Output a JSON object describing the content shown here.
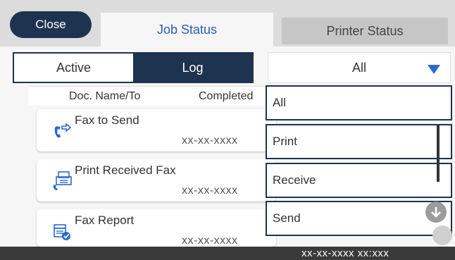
{
  "header": {
    "close_label": "Close",
    "tabs": [
      {
        "label": "Job Status",
        "active": true
      },
      {
        "label": "Printer Status",
        "active": false
      }
    ]
  },
  "segment": {
    "active_label": "Active",
    "log_label": "Log",
    "selected": "Log"
  },
  "filter": {
    "selected": "All",
    "options": [
      "All",
      "Print",
      "Receive",
      "Send"
    ]
  },
  "columns": {
    "doc_name": "Doc. Name/To",
    "completed": "Completed"
  },
  "jobs": [
    {
      "title": "Fax to Send",
      "date": "xx-xx-xxxx",
      "icon": "fax-send-icon"
    },
    {
      "title": "Print Received Fax",
      "date": "xx-xx-xxxx",
      "icon": "print-received-fax-icon"
    },
    {
      "title": "Fax Report",
      "date": "xx-xx-xxxx",
      "icon": "fax-report-icon"
    }
  ],
  "status_bar": {
    "datetime": "xx-xx-xxxx xx:xxx"
  },
  "colors": {
    "navy": "#1e3350",
    "accent_blue": "#2b6ad0",
    "tab_text": "#2b5db8"
  }
}
